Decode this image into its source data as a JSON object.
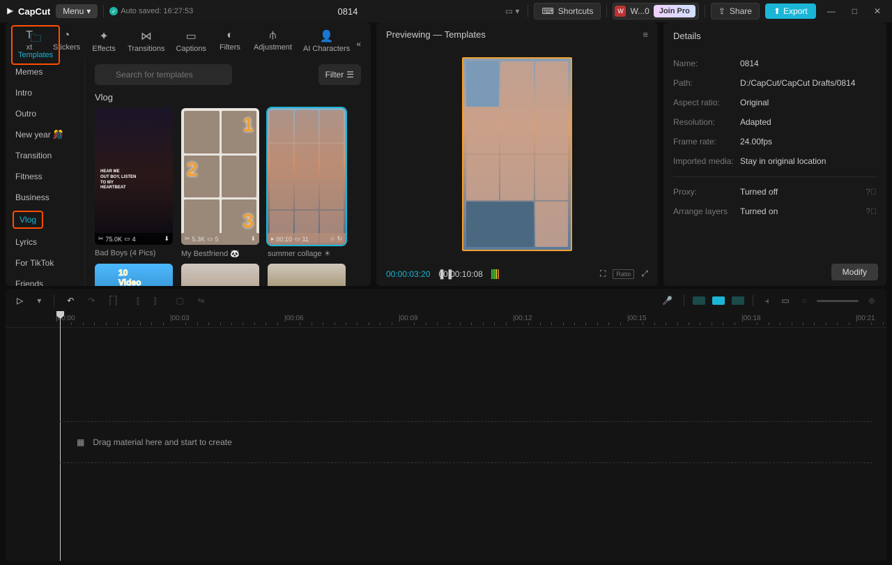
{
  "titlebar": {
    "logo": "CapCut",
    "menu": "Menu",
    "autosave": "Auto saved: 16:27:53",
    "project": "0814",
    "shortcuts": "Shortcuts",
    "user": "W...0",
    "joinpro": "Join Pro",
    "share": "Share",
    "export": "Export"
  },
  "tabs": [
    "xt",
    "Stickers",
    "Effects",
    "Transitions",
    "Captions",
    "Filters",
    "Adjustment",
    "Templates",
    "AI Characters"
  ],
  "active_tab": "Templates",
  "categories": [
    "Memes",
    "Intro",
    "Outro",
    "New year 🎊",
    "Transition",
    "Fitness",
    "Business",
    "Vlog",
    "Lyrics",
    "For TikTok",
    "Friends"
  ],
  "active_category": "Vlog",
  "search_placeholder": "Search for templates",
  "filter_label": "Filter",
  "section_title": "Vlog",
  "templates": [
    {
      "title": "Bad Boys (4 Pics)",
      "meta_left": "75.0K",
      "meta_right": "4",
      "dl": true
    },
    {
      "title": "My Bestfriend 🐼",
      "meta_left": "5.3K",
      "meta_right": "5",
      "dl": true
    },
    {
      "title": "summer collage ☀",
      "meta_left": "00:10",
      "meta_right": "11",
      "selected": true
    }
  ],
  "preview": {
    "title": "Previewing — Templates",
    "current": "00:00:03:20",
    "total": "00:00:10:08",
    "ratio": "Ratio"
  },
  "details": {
    "heading": "Details",
    "rows": [
      {
        "label": "Name:",
        "value": "0814"
      },
      {
        "label": "Path:",
        "value": "D:/CapCut/CapCut Drafts/0814"
      },
      {
        "label": "Aspect ratio:",
        "value": "Original"
      },
      {
        "label": "Resolution:",
        "value": "Adapted"
      },
      {
        "label": "Frame rate:",
        "value": "24.00fps"
      },
      {
        "label": "Imported media:",
        "value": "Stay in original location"
      }
    ],
    "rows2": [
      {
        "label": "Proxy:",
        "value": "Turned off",
        "help": true
      },
      {
        "label": "Arrange layers",
        "value": "Turned on",
        "help": true
      }
    ],
    "modify": "Modify"
  },
  "timeline": {
    "marks": [
      "00:00",
      "00:03",
      "00:06",
      "00:09",
      "00:12",
      "00:15",
      "00:18",
      "00:21"
    ],
    "drop_hint": "Drag material here and start to create"
  }
}
